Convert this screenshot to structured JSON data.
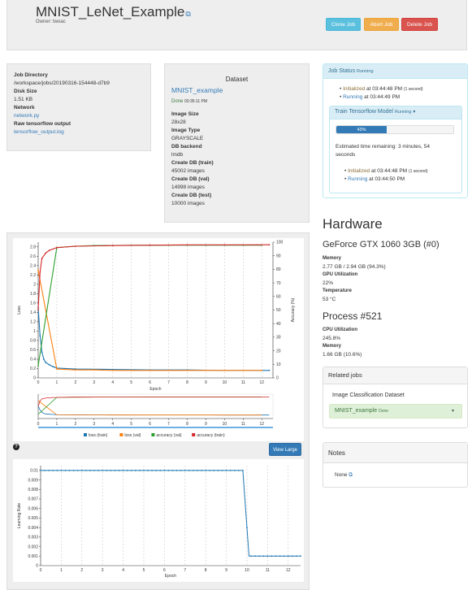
{
  "header": {
    "title": "MNIST_LeNet_Example",
    "edit_icon": "external-edit-icon",
    "owner": "Owner: twoac",
    "buttons": {
      "clone": "Clone Job",
      "abort": "Abort Job",
      "delete": "Delete Job"
    },
    "colors": {
      "clone": "#5bc0de",
      "abort": "#f0ad4e",
      "delete": "#d9534f"
    }
  },
  "job_info": {
    "dir_label": "Job Directory",
    "dir_value": "/workspace/jobs/20190316-154448-d7b9",
    "disk_label": "Disk Size",
    "disk_value": "1.51 KB",
    "network_label": "Network",
    "network_link": "network.py",
    "raw_label": "Raw tensorflow output",
    "raw_link": "tensorflow_output.log"
  },
  "dataset": {
    "heading": "Dataset",
    "name": "MNIST_example",
    "status": "Done",
    "status_time": "03:35:11 PM",
    "rows": [
      {
        "label": "Image Size",
        "value": "28x28"
      },
      {
        "label": "Image Type",
        "value": "GRAYSCALE"
      },
      {
        "label": "DB backend",
        "value": "lmdb"
      },
      {
        "label": "Create DB (train)",
        "value": "45002 images"
      },
      {
        "label": "Create DB (val)",
        "value": "14998 images"
      },
      {
        "label": "Create DB (test)",
        "value": "10000 images"
      }
    ]
  },
  "job_status": {
    "title": "Job Status",
    "state": "Running",
    "events": [
      {
        "name": "Initialized",
        "time": "at 03:44:48 PM",
        "dur": "(1 second)"
      },
      {
        "name": "Running",
        "time": "at 03:44:49 PM",
        "dur": ""
      }
    ],
    "task_title": "Train Tensorflow Model",
    "task_state": "Running",
    "progress_label": "43%",
    "progress": 0.43,
    "eta": "Estimated time remaining: 3 minutes, 54 seconds",
    "task_events": [
      {
        "name": "Initialized",
        "time": "at 03:44:48 PM",
        "dur": "(1 second)"
      },
      {
        "name": "Running",
        "time": "at 03:44:50 PM",
        "dur": ""
      }
    ]
  },
  "hardware": {
    "heading": "Hardware",
    "gpu": "GeForce GTX 1060 3GB (#0)",
    "rows": [
      {
        "label": "Memory",
        "value": "2.77 GB / 2.94 GB (94.3%)"
      },
      {
        "label": "GPU Utilization",
        "value": "22%"
      },
      {
        "label": "Temperature",
        "value": "53 °C"
      }
    ],
    "process_heading": "Process #521",
    "process_rows": [
      {
        "label": "CPU Utilization",
        "value": "245.8%"
      },
      {
        "label": "Memory",
        "value": "1.66 GB (10.6%)"
      }
    ]
  },
  "related": {
    "heading": "Related jobs",
    "sub": "Image Classification Dataset",
    "item": "MNIST_example",
    "item_state": "Done"
  },
  "notes": {
    "heading": "Notes",
    "value": "None"
  },
  "view_large": "View Large",
  "help_icon": "question-circle-icon",
  "colors": {
    "loss_train": "#1f77b4",
    "loss_val": "#ff7f0e",
    "acc_val": "#2ca02c",
    "acc_train": "#d62728"
  },
  "chart_data": [
    {
      "type": "line",
      "xlabel": "Epoch",
      "ylabel": "Loss",
      "y2label": "Accuracy (%)",
      "xlim": [
        0,
        12.6
      ],
      "ylim": [
        0,
        2.9
      ],
      "y2lim": [
        0,
        100
      ],
      "x_ticks": [
        "0",
        "1",
        "2",
        "3",
        "4",
        "5",
        "6",
        "7",
        "8",
        "9",
        "10",
        "11",
        "12"
      ],
      "y_ticks": [
        "0",
        "0.2",
        "0.4",
        "0.6",
        "0.8",
        "1",
        "1.2",
        "1.4",
        "1.6",
        "1.8",
        "2",
        "2.2",
        "2.4",
        "2.6",
        "2.8"
      ],
      "y2_ticks": [
        "0",
        "10",
        "20",
        "30",
        "40",
        "50",
        "60",
        "70",
        "80",
        "90",
        "100"
      ],
      "series": [
        {
          "name": "loss (train)",
          "axis": "left",
          "x": [
            0,
            0.1,
            0.2,
            0.3,
            0.4,
            0.6,
            0.8,
            1,
            2,
            4,
            6,
            8,
            10,
            12.4
          ],
          "y": [
            1.5,
            0.9,
            0.55,
            0.4,
            0.33,
            0.28,
            0.24,
            0.21,
            0.19,
            0.18,
            0.17,
            0.17,
            0.16,
            0.16
          ]
        },
        {
          "name": "loss (val)",
          "axis": "left",
          "x": [
            0,
            1,
            2,
            3,
            4,
            5,
            6,
            7,
            8,
            9,
            10,
            11,
            12
          ],
          "y": [
            2.3,
            0.19,
            0.17,
            0.17,
            0.16,
            0.16,
            0.16,
            0.16,
            0.16,
            0.16,
            0.16,
            0.16,
            0.16
          ]
        },
        {
          "name": "accuracy (val)",
          "axis": "right",
          "x": [
            0,
            1,
            2,
            3,
            4,
            5,
            6,
            7,
            8,
            9,
            10,
            11,
            12
          ],
          "y": [
            9,
            96,
            97,
            97.5,
            97.6,
            97.7,
            97.7,
            97.8,
            97.8,
            97.8,
            97.8,
            97.8,
            97.8
          ]
        },
        {
          "name": "accuracy (train)",
          "axis": "right",
          "x": [
            0,
            0.1,
            0.2,
            0.4,
            0.6,
            1,
            2,
            4,
            6,
            8,
            10,
            12.4
          ],
          "y": [
            50,
            78,
            88,
            92,
            94,
            96,
            97,
            97.5,
            97.8,
            98,
            98,
            98.1
          ]
        }
      ],
      "legend": [
        "loss (train)",
        "loss (val)",
        "accuracy (val)",
        "accuracy (train)"
      ],
      "legend_position": "bottom"
    },
    {
      "type": "line",
      "xlabel": "Epoch",
      "ylabel": "Learning Rate",
      "xlim": [
        0,
        12.6
      ],
      "ylim": [
        0,
        0.0105
      ],
      "x_ticks": [
        "0",
        "1",
        "2",
        "3",
        "4",
        "5",
        "6",
        "7",
        "8",
        "9",
        "10",
        "11",
        "12"
      ],
      "y_ticks": [
        "0",
        "0.001",
        "0.002",
        "0.003",
        "0.004",
        "0.005",
        "0.006",
        "0.007",
        "0.008",
        "0.009",
        "0.01"
      ],
      "series": [
        {
          "name": "learning rate",
          "x": [
            0,
            9.8,
            10.1,
            12.6
          ],
          "y": [
            0.01,
            0.01,
            0.001,
            0.001
          ]
        }
      ]
    }
  ]
}
